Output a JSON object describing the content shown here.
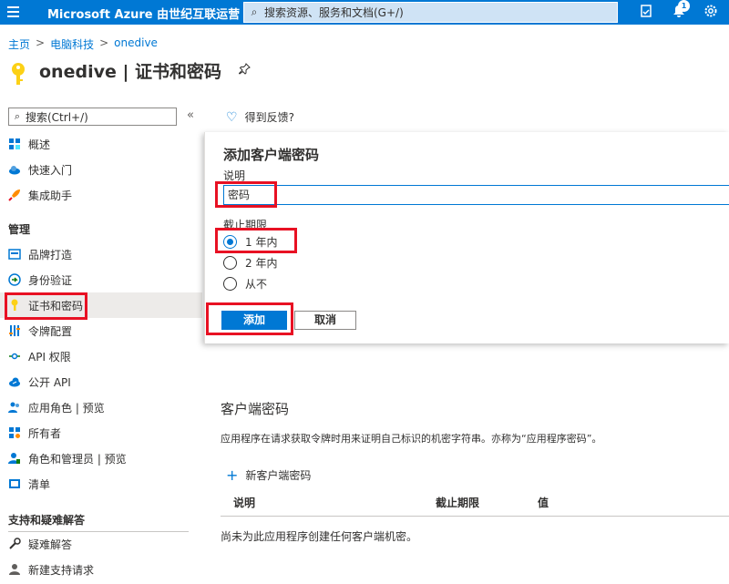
{
  "topbar": {
    "brand": "Microsoft Azure 由世纪互联运营",
    "search_placeholder": "搜索资源、服务和文档(G+/)",
    "notification_count": "1"
  },
  "breadcrumb": [
    "主页",
    "电脑科技",
    "onedive"
  ],
  "page_title": "onedive | 证书和密码",
  "sidebar": {
    "search_placeholder": "搜索(Ctrl+/)",
    "items_top": [
      "概述",
      "快速入门",
      "集成助手"
    ],
    "section_manage": "管理",
    "items_manage": [
      "品牌打造",
      "身份验证",
      "证书和密码",
      "令牌配置",
      "API 权限",
      "公开 API",
      "应用角色 | 预览",
      "所有者",
      "角色和管理员 | 预览",
      "清单"
    ],
    "section_support": "支持和疑难解答",
    "items_support": [
      "疑难解答",
      "新建支持请求"
    ]
  },
  "feedback": "得到反馈?",
  "dialog": {
    "title": "添加客户端密码",
    "desc_label": "说明",
    "desc_value": "密码",
    "expiry_label": "截止期限",
    "options": [
      "1 年内",
      "2 年内",
      "从不"
    ],
    "selected_option": "1 年内",
    "add_button": "添加",
    "cancel_button": "取消"
  },
  "client_secrets": {
    "title": "客户端密码",
    "description": "应用程序在请求获取令牌时用来证明自己标识的机密字符串。亦称为“应用程序密码”。",
    "new_button": "新客户端密码",
    "columns": [
      "说明",
      "截止期限",
      "值"
    ],
    "empty_text": "尚未为此应用程序创建任何客户端机密。"
  },
  "colors": {
    "accent": "#0078d4",
    "highlight": "#e81123"
  }
}
